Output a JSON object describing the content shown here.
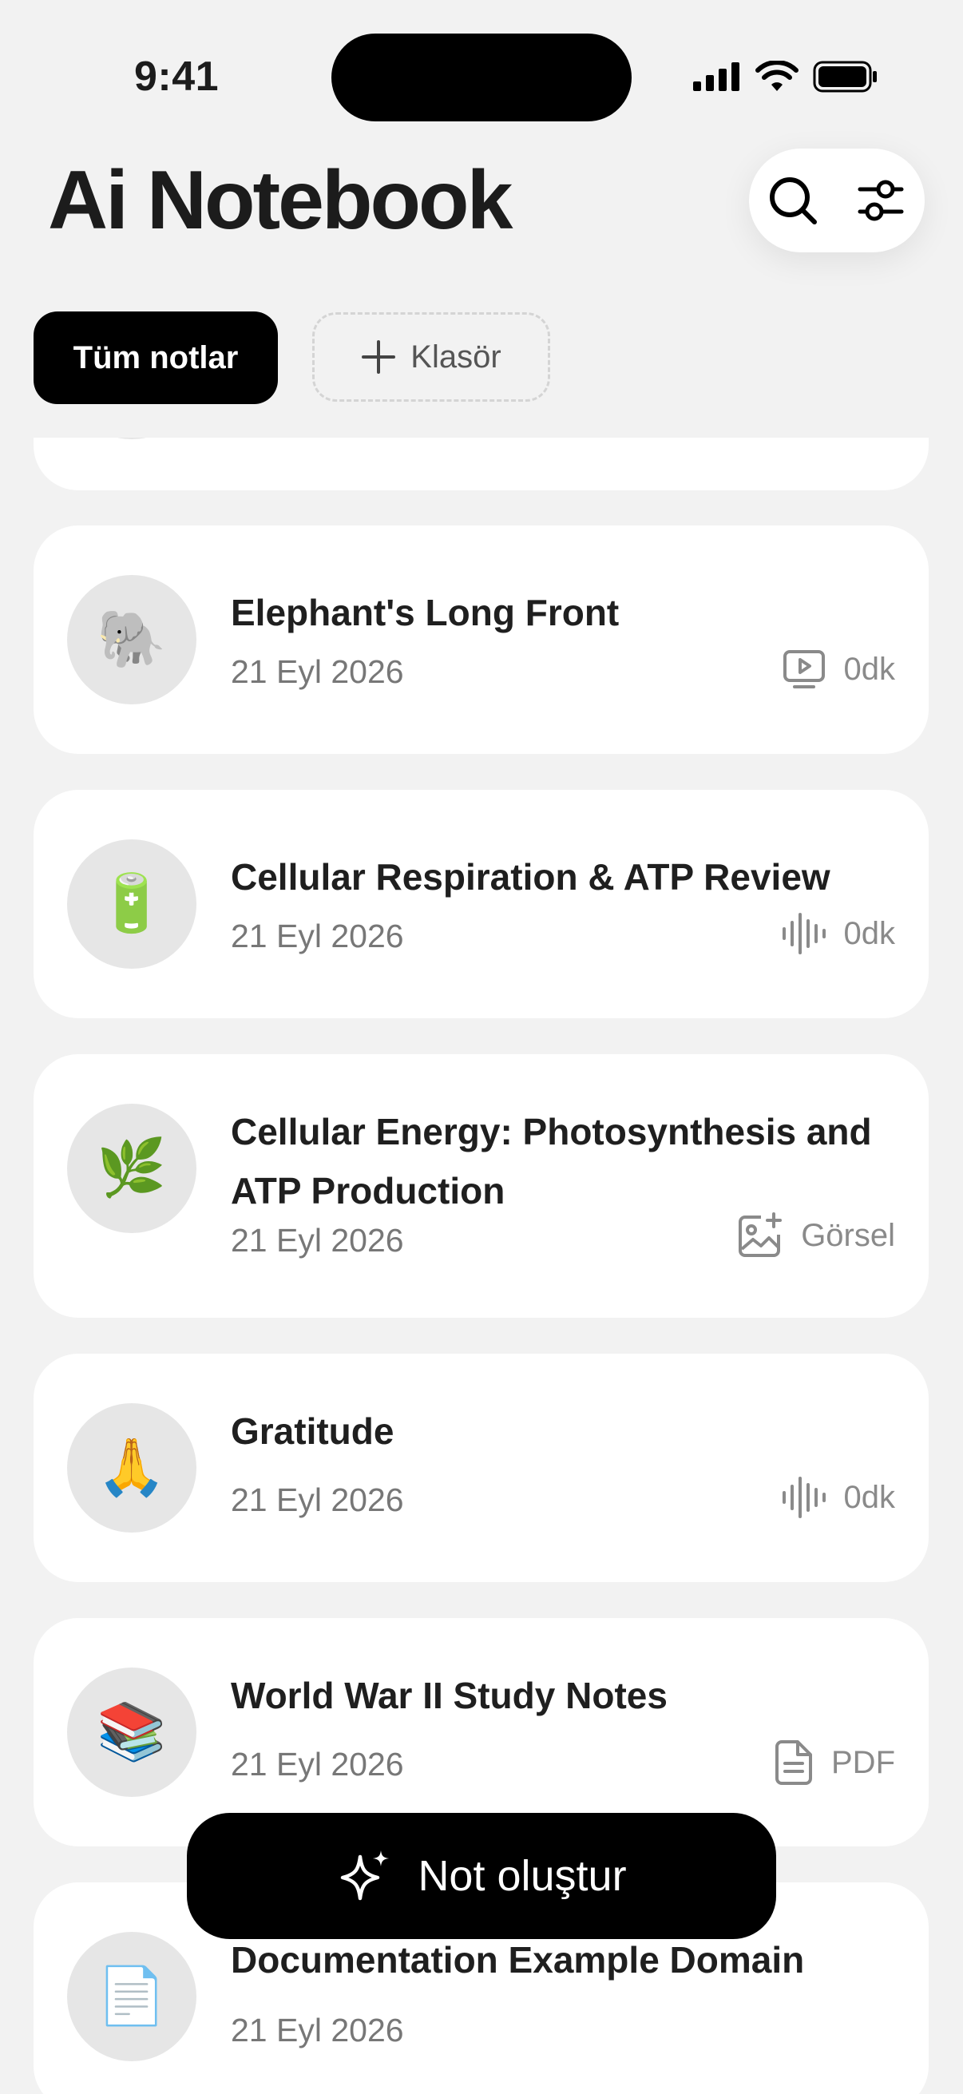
{
  "status_bar": {
    "time": "9:41"
  },
  "header": {
    "title": "Ai Notebook"
  },
  "filters": {
    "all_notes": "Tüm notlar",
    "add_folder": "Klasör"
  },
  "notes": [
    {
      "title": "Elephant's Long Front",
      "date": "21 Eyl 2026",
      "type": "video",
      "meta": "0dk",
      "emoji": "🐘"
    },
    {
      "title": "Cellular Respiration & ATP Review",
      "date": "21 Eyl 2026",
      "type": "audio",
      "meta": "0dk",
      "emoji": "🔋"
    },
    {
      "title": "Cellular Energy: Photosynthesis and ATP Production",
      "date": "21 Eyl 2026",
      "type": "image",
      "meta": "Görsel",
      "emoji": "🌿"
    },
    {
      "title": "Gratitude",
      "date": "21 Eyl 2026",
      "type": "audio",
      "meta": "0dk",
      "emoji": "🙏"
    },
    {
      "title": "World War II Study Notes",
      "date": "21 Eyl 2026",
      "type": "pdf",
      "meta": "PDF",
      "emoji": "📚"
    },
    {
      "title": "Documentation Example Domain",
      "date": "21 Eyl 2026",
      "type": "web",
      "meta": "",
      "emoji": "📄"
    }
  ],
  "fab": {
    "label": "Not oluştur"
  }
}
